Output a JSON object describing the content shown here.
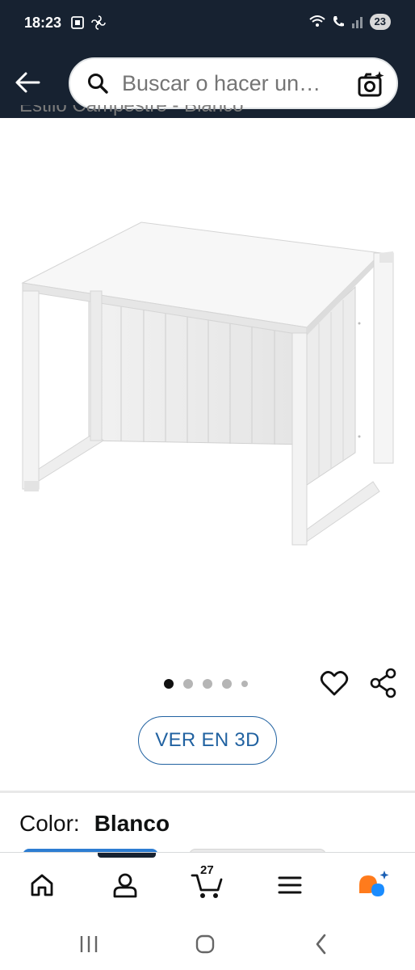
{
  "status_bar": {
    "time": "18:23",
    "battery": "23",
    "icons": [
      "screenshot-icon",
      "fan-icon",
      "wifi-icon",
      "call-icon",
      "signal-icon"
    ]
  },
  "header": {
    "back_icon": "back-arrow-icon",
    "search_placeholder": "Buscar o hacer un…",
    "camera_icon": "camera-search-icon"
  },
  "product": {
    "partial_title": "Estilo Campestre - Blanco",
    "image_icon": "white-bench-desk-image",
    "carousel": {
      "count": 5,
      "active": 0
    }
  },
  "actions": {
    "heart_icon": "heart-icon",
    "share_icon": "share-icon",
    "ver3d_label": "VER EN 3D"
  },
  "variant": {
    "color_label": "Color:",
    "color_value": "Blanco"
  },
  "bottom_nav": {
    "items": [
      "home-icon",
      "account-icon",
      "cart-icon",
      "menu-icon",
      "rufus-icon"
    ],
    "cart_count": "27"
  },
  "system_nav": [
    "recents-icon",
    "home-icon",
    "back-icon"
  ],
  "colors": {
    "header_bg": "#172231",
    "link_blue": "#2162a1",
    "accent_orange": "#ff7b1c",
    "accent_blue": "#1a8cff"
  }
}
